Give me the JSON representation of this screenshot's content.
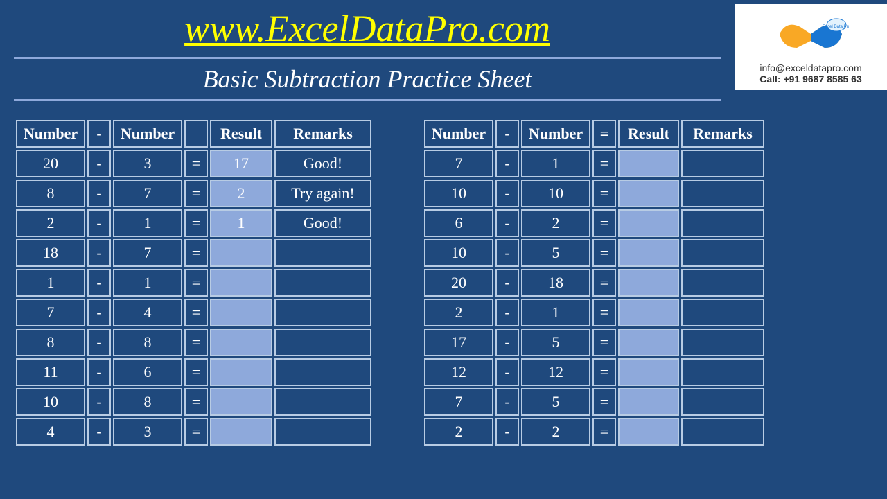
{
  "header": {
    "site_url": "www.ExcelDataPro.com",
    "subtitle": "Basic Subtraction Practice Sheet"
  },
  "logo": {
    "email": "info@exceldatapro.com",
    "phone": "Call: +91 9687 8585 63"
  },
  "headers": {
    "number": "Number",
    "minus": "-",
    "equals": "=",
    "result": "Result",
    "remarks": "Remarks"
  },
  "left_table": [
    {
      "a": "20",
      "op": "-",
      "b": "3",
      "eq": "=",
      "result": "17",
      "remarks": "Good!"
    },
    {
      "a": "8",
      "op": "-",
      "b": "7",
      "eq": "=",
      "result": "2",
      "remarks": "Try again!"
    },
    {
      "a": "2",
      "op": "-",
      "b": "1",
      "eq": "=",
      "result": "1",
      "remarks": "Good!"
    },
    {
      "a": "18",
      "op": "-",
      "b": "7",
      "eq": "=",
      "result": "",
      "remarks": ""
    },
    {
      "a": "1",
      "op": "-",
      "b": "1",
      "eq": "=",
      "result": "",
      "remarks": ""
    },
    {
      "a": "7",
      "op": "-",
      "b": "4",
      "eq": "=",
      "result": "",
      "remarks": ""
    },
    {
      "a": "8",
      "op": "-",
      "b": "8",
      "eq": "=",
      "result": "",
      "remarks": ""
    },
    {
      "a": "11",
      "op": "-",
      "b": "6",
      "eq": "=",
      "result": "",
      "remarks": ""
    },
    {
      "a": "10",
      "op": "-",
      "b": "8",
      "eq": "=",
      "result": "",
      "remarks": ""
    },
    {
      "a": "4",
      "op": "-",
      "b": "3",
      "eq": "=",
      "result": "",
      "remarks": ""
    }
  ],
  "right_table": [
    {
      "a": "7",
      "op": "-",
      "b": "1",
      "eq": "=",
      "result": "",
      "remarks": ""
    },
    {
      "a": "10",
      "op": "-",
      "b": "10",
      "eq": "=",
      "result": "",
      "remarks": ""
    },
    {
      "a": "6",
      "op": "-",
      "b": "2",
      "eq": "=",
      "result": "",
      "remarks": ""
    },
    {
      "a": "10",
      "op": "-",
      "b": "5",
      "eq": "=",
      "result": "",
      "remarks": ""
    },
    {
      "a": "20",
      "op": "-",
      "b": "18",
      "eq": "=",
      "result": "",
      "remarks": ""
    },
    {
      "a": "2",
      "op": "-",
      "b": "1",
      "eq": "=",
      "result": "",
      "remarks": ""
    },
    {
      "a": "17",
      "op": "-",
      "b": "5",
      "eq": "=",
      "result": "",
      "remarks": ""
    },
    {
      "a": "12",
      "op": "-",
      "b": "12",
      "eq": "=",
      "result": "",
      "remarks": ""
    },
    {
      "a": "7",
      "op": "-",
      "b": "5",
      "eq": "=",
      "result": "",
      "remarks": ""
    },
    {
      "a": "2",
      "op": "-",
      "b": "2",
      "eq": "=",
      "result": "",
      "remarks": ""
    }
  ]
}
